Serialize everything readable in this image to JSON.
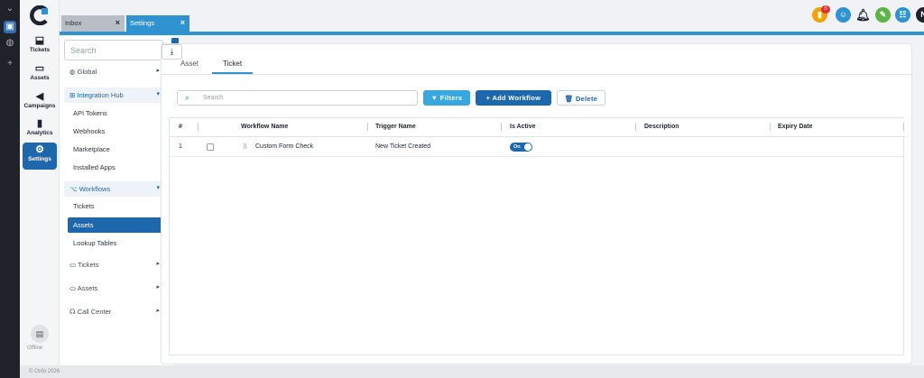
{
  "outer_icons": [
    "chevron-down-icon",
    "app-icon",
    "globe-icon",
    "plus-icon"
  ],
  "rail": {
    "items": [
      {
        "label": "Tickets",
        "icon": "inbox-icon"
      },
      {
        "label": "Assets",
        "icon": "monitor-icon"
      },
      {
        "label": "Campaigns",
        "icon": "megaphone-icon"
      },
      {
        "label": "Analytics",
        "icon": "bar-chart-icon"
      },
      {
        "label": "Settings",
        "icon": "gear-icon",
        "active": true
      }
    ],
    "status": "Offline"
  },
  "footer": "© Onfo 2026",
  "tabs": [
    {
      "label": "Inbox"
    },
    {
      "label": "Settings"
    }
  ],
  "topbar": {
    "badge": "0",
    "avatar": "N"
  },
  "sidebar": {
    "search_placeholder": "Search",
    "items": [
      {
        "label": "Global"
      },
      {
        "label": "Integration Hub"
      },
      {
        "label": "API Tokens"
      },
      {
        "label": "Webhooks"
      },
      {
        "label": "Marketplace"
      },
      {
        "label": "Installed Apps"
      },
      {
        "label": "Workflows"
      },
      {
        "label": "Tickets"
      },
      {
        "label": "Assets"
      },
      {
        "label": "Lookup Tables"
      },
      {
        "label": "Tickets"
      },
      {
        "label": "Assets"
      },
      {
        "label": "Call Center"
      }
    ]
  },
  "page_tabs": [
    {
      "label": "Asset"
    },
    {
      "label": "Ticket"
    }
  ],
  "toolbar": {
    "search_placeholder": "Search",
    "filters": "Filters",
    "add": "+ Add Workflow",
    "delete": "Delete"
  },
  "table": {
    "headers": [
      "#",
      "Workflow Name",
      "Trigger Name",
      "Is Active",
      "Description",
      "Expiry Date"
    ],
    "rows": [
      {
        "num": "1",
        "name": "Custom Form Check",
        "trigger": "New Ticket Created",
        "active": "On",
        "description": "",
        "expiry": ""
      }
    ]
  }
}
